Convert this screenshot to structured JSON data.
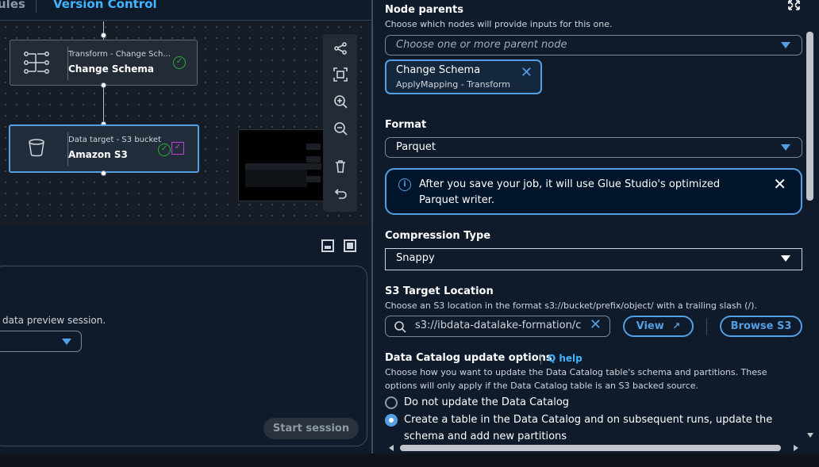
{
  "tabs": {
    "inactive": "ules",
    "active": "Version Control"
  },
  "canvas": {
    "nodes": [
      {
        "subtitle": "Transform - Change Sch...",
        "name": "Change Schema"
      },
      {
        "subtitle": "Data target - S3 bucket",
        "name": "Amazon S3"
      }
    ],
    "toolbar_icons": [
      "layout-icon",
      "fit-view-icon",
      "zoom-in-icon",
      "zoom-out-icon",
      "delete-icon",
      "undo-icon"
    ]
  },
  "preview": {
    "text": "data preview session.",
    "start_button": "Start session"
  },
  "node_parents": {
    "label": "Node parents",
    "description": "Choose which nodes will provide inputs for this one.",
    "placeholder": "Choose one or more parent node",
    "token": {
      "name": "Change Schema",
      "type": "ApplyMapping - Transform"
    }
  },
  "format": {
    "label": "Format",
    "value": "Parquet",
    "alert": "After you save your job, it will use Glue Studio's optimized Parquet writer."
  },
  "compression": {
    "label": "Compression Type",
    "value": "Snappy"
  },
  "s3_target": {
    "label": "S3 Target Location",
    "description": "Choose an S3 location in the format s3://bucket/prefix/object/ with a trailing slash (/).",
    "value": "s3://ibdata-datalake-formation/c",
    "view_button": "View",
    "browse_button": "Browse S3"
  },
  "catalog": {
    "label": "Data Catalog update options",
    "help": "Q help",
    "description": "Choose how you want to update the Data Catalog table's schema and partitions. These options will only apply if the Data Catalog table is an S3 backed source.",
    "options": [
      {
        "label": "Do not update the Data Catalog",
        "selected": false
      },
      {
        "label": "Create a table in the Data Catalog and on subsequent runs, update the schema and add new partitions",
        "selected": true
      }
    ]
  },
  "colors": {
    "accent": "#539fe5",
    "link": "#42b4ff",
    "success": "#29ad32",
    "purple": "#c33ee0",
    "background": "#0f1b2a"
  }
}
